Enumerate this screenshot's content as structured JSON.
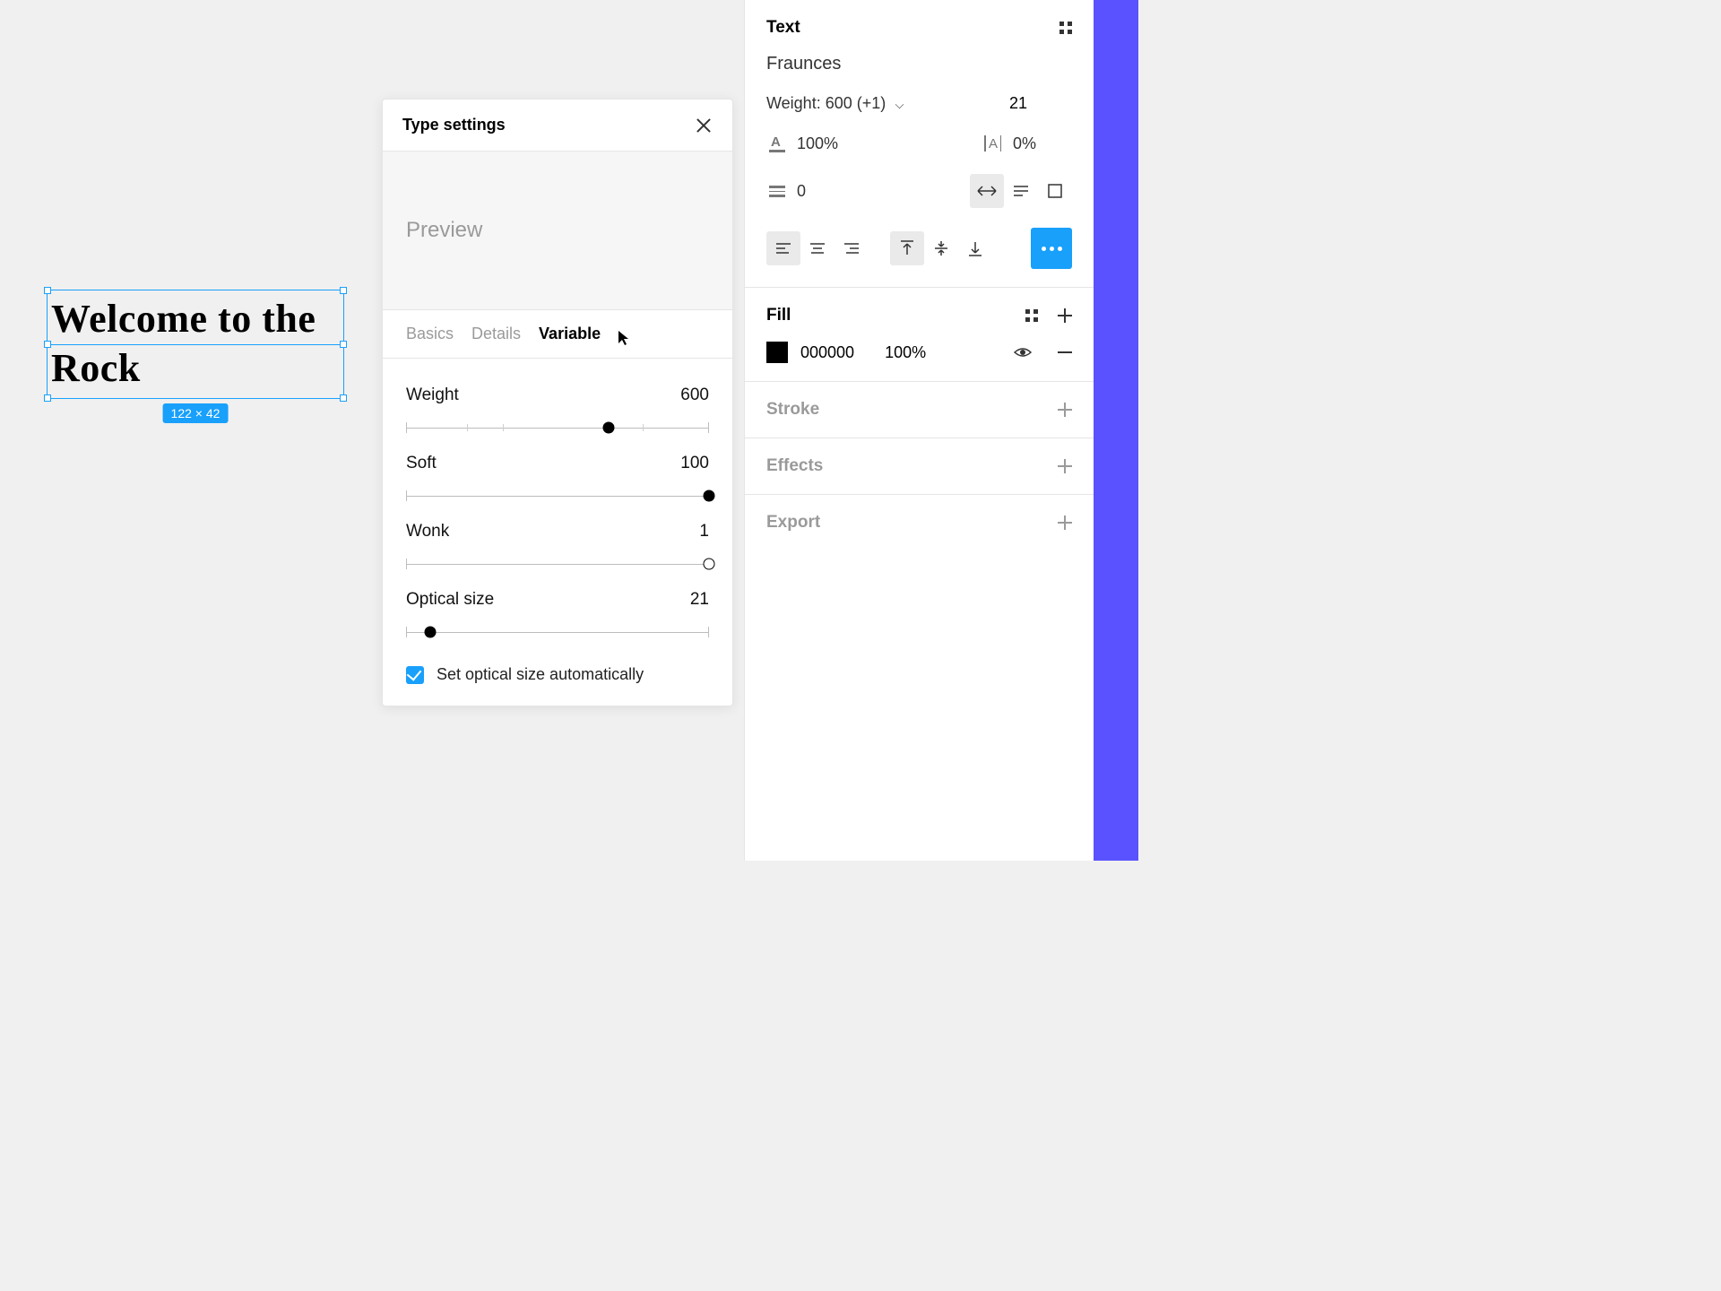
{
  "canvas": {
    "selected_text": "Welcome to the Rock",
    "dimensions": "122 × 42"
  },
  "popover": {
    "title": "Type settings",
    "preview_label": "Preview",
    "tabs": {
      "basics": "Basics",
      "details": "Details",
      "variable": "Variable"
    },
    "sliders": {
      "weight": {
        "label": "Weight",
        "value": "600",
        "percent": 67,
        "ticks": [
          20,
          40,
          60,
          80
        ]
      },
      "soft": {
        "label": "Soft",
        "value": "100",
        "percent": 100
      },
      "wonk": {
        "label": "Wonk",
        "value": "1",
        "percent": 100
      },
      "optical": {
        "label": "Optical size",
        "value": "21",
        "percent": 8
      }
    },
    "checkbox_label": "Set optical size automatically"
  },
  "inspector": {
    "text": {
      "section_title": "Text",
      "font_name": "Fraunces",
      "weight_label": "Weight: 600 (+1)",
      "font_size": "21",
      "line_height": "100%",
      "letter_spacing": "0%",
      "paragraph_spacing": "0"
    },
    "fill": {
      "section_title": "Fill",
      "hex": "000000",
      "opacity": "100%"
    },
    "stroke": {
      "section_title": "Stroke"
    },
    "effects": {
      "section_title": "Effects"
    },
    "export": {
      "section_title": "Export"
    }
  }
}
